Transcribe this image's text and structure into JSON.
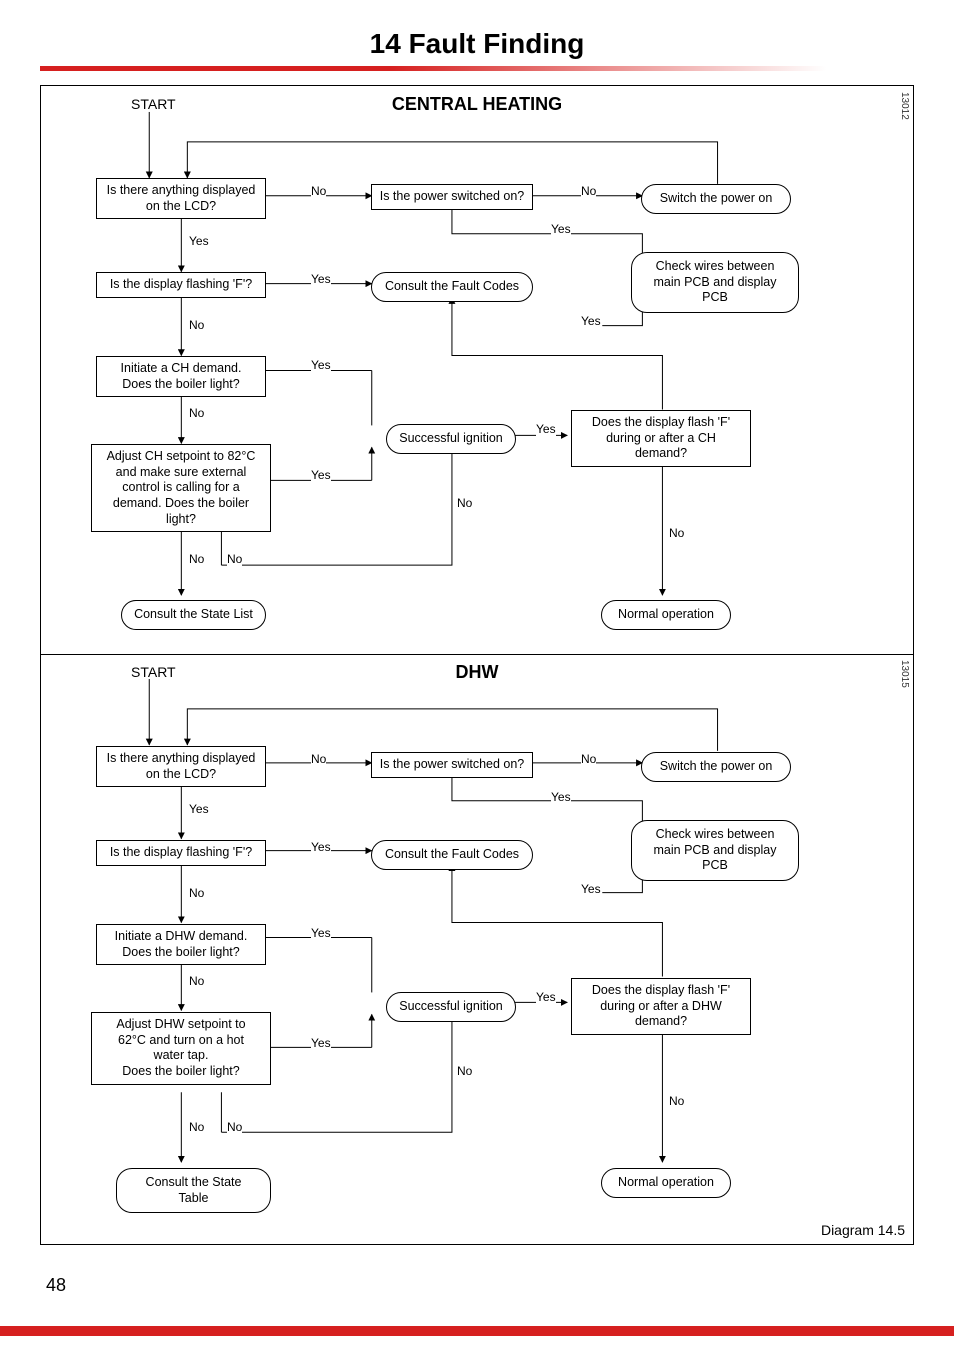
{
  "heading": "14  Fault Finding",
  "ch": {
    "title": "CENTRAL HEATING",
    "start": "START",
    "id": "13012",
    "boxes": {
      "lcd": "Is there anything displayed\non the LCD?",
      "power": "Is the power switched on?",
      "switchon": "Switch the power on",
      "flashF": "Is the display flashing 'F'?",
      "fault": "Consult the Fault Codes",
      "wires": "Check wires between\nmain PCB and display\nPCB",
      "initiate": "Initiate a CH demand.\nDoes the boiler light?",
      "success": "Successful ignition",
      "flash2": "Does the display flash 'F'\nduring or after a CH\ndemand?",
      "adjust": "Adjust CH setpoint to 82°C\nand make sure external\ncontrol is calling for a\ndemand. Does the boiler\nlight?",
      "state": "Consult the State List",
      "normal": "Normal operation"
    }
  },
  "dhw": {
    "title": "DHW",
    "start": "START",
    "id": "13015",
    "boxes": {
      "lcd": "Is there anything displayed\non the LCD?",
      "power": "Is the power switched on?",
      "switchon": "Switch the power on",
      "flashF": "Is the display flashing 'F'?",
      "fault": "Consult the Fault Codes",
      "wires": "Check wires between\nmain PCB and display\nPCB",
      "initiate": "Initiate a DHW demand.\nDoes the boiler light?",
      "success": "Successful ignition",
      "flash2": "Does the display flash 'F'\nduring or after a DHW\ndemand?",
      "adjust": "Adjust DHW setpoint to\n62°C and turn on a hot\nwater tap.\nDoes the boiler light?",
      "state": "Consult the State Table",
      "normal": "Normal operation"
    }
  },
  "labels": {
    "yes": "Yes",
    "no": "No"
  },
  "diagref": "Diagram 14.5",
  "pagenum": "48"
}
